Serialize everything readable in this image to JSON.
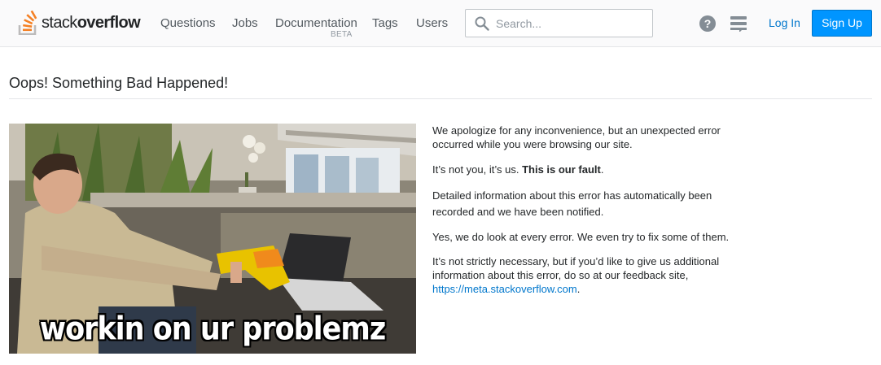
{
  "header": {
    "logo": {
      "text_light": "stack",
      "text_bold": "overflow",
      "icon": "stackoverflow-logo-icon"
    },
    "nav": [
      {
        "label": "Questions"
      },
      {
        "label": "Jobs"
      },
      {
        "label": "Documentation",
        "badge": "BETA"
      },
      {
        "label": "Tags"
      },
      {
        "label": "Users"
      }
    ],
    "search": {
      "placeholder": "Search...",
      "value": "",
      "icon": "search-icon"
    },
    "help_icon_glyph": "?",
    "review_icon": "review-queue-icon",
    "login_label": "Log In",
    "signup_label": "Sign Up"
  },
  "main": {
    "title": "Oops! Something Bad Happened!",
    "image": {
      "caption": "workin on ur problemz"
    },
    "paragraphs": {
      "p1": "We apologize for any inconvenience, but an unexpected error occurred while you were browsing our site.",
      "p2_prefix": "It’s not you, it’s us. ",
      "p2_bold": "This is our fault",
      "p2_suffix": ".",
      "p3": "Detailed information about this error has automatically been recorded and we have been notified.",
      "p4": "Yes, we do look at every error. We even try to fix some of them.",
      "p5_prefix": "It’s not strictly necessary, but if you’d like to give us additional information about this error, do so at our feedback site, ",
      "p5_link": "https://meta.stackoverflow.com",
      "p5_suffix": "."
    }
  },
  "colors": {
    "brand_orange": "#f48024",
    "link_blue": "#0077cc",
    "signup_blue": "#0095ff"
  }
}
